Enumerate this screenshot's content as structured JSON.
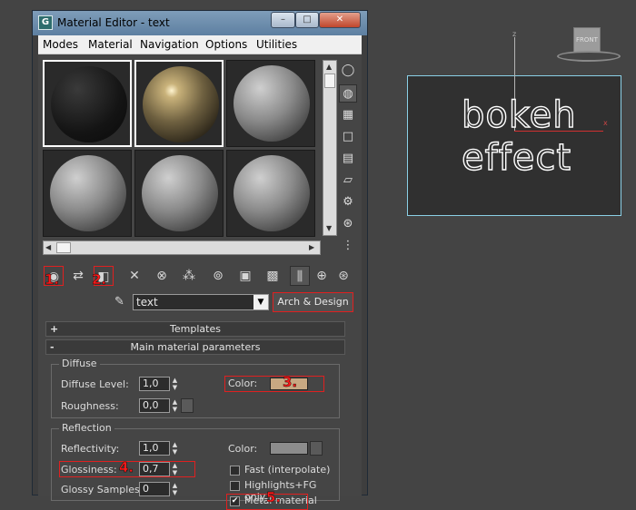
{
  "window": {
    "title": "Material Editor - text",
    "app_icon": "G",
    "minimize": "–",
    "maximize": "□",
    "close": "✕"
  },
  "menu": [
    "Modes",
    "Material",
    "Navigation",
    "Options",
    "Utilities"
  ],
  "slots": [
    {
      "sphere": "dark",
      "active": true
    },
    {
      "sphere": "gold",
      "active": true
    },
    {
      "sphere": "grey",
      "active": false
    },
    {
      "sphere": "grey",
      "active": false
    },
    {
      "sphere": "grey",
      "active": false
    },
    {
      "sphere": "grey",
      "active": false
    }
  ],
  "side_tools": [
    "sample-type-icon",
    "backlight-icon",
    "background-icon",
    "uv-tiling-icon",
    "video-color-check-icon",
    "make-preview-icon",
    "options-icon",
    "select-by-material-icon",
    "material-map-navigator-icon"
  ],
  "toolbar": {
    "icons": [
      "get-material-icon",
      "put-to-scene-icon",
      "assign-to-selection-icon",
      "reset-map-icon",
      "make-unique-icon",
      "put-to-library-icon",
      "material-id-channel-icon",
      "show-map-in-viewport-icon",
      "show-end-result-icon",
      "go-to-parent-icon",
      "go-forward-to-sibling-icon",
      "go-to-sibling-icon"
    ],
    "markers": [
      "1.",
      "2."
    ]
  },
  "material_name": {
    "value": "text",
    "dropdown_arrow": "▼",
    "type_button": "Arch & Design"
  },
  "rollouts": {
    "templates": {
      "sign": "+",
      "label": "Templates"
    },
    "main": {
      "sign": "-",
      "label": "Main material parameters"
    }
  },
  "diffuse": {
    "title": "Diffuse",
    "level_label": "Diffuse Level:",
    "level_value": "1,0",
    "roughness_label": "Roughness:",
    "roughness_value": "0,0",
    "color_label": "Color:",
    "color_hex": "#c8a882",
    "marker": "3."
  },
  "reflection": {
    "title": "Reflection",
    "reflectivity_label": "Reflectivity:",
    "reflectivity_value": "1,0",
    "glossiness_label": "Glossiness:",
    "glossiness_value": "0,7",
    "glossy_samples_label": "Glossy Samples:",
    "glossy_samples_value": "0",
    "color_label": "Color:",
    "color_hex": "#8c8c8c",
    "fast_label": "Fast (interpolate)",
    "fast_checked": false,
    "highlights_label": "Highlights+FG only",
    "highlights_checked": false,
    "metal_label": "Metal material",
    "metal_checked": true,
    "marker_glossiness": "4.",
    "marker_metal": "5."
  },
  "viewport": {
    "text_line1": "bokeh",
    "text_line2": "effect",
    "axis_x": "x",
    "axis_z": "z",
    "viewcube_label": "FRONT"
  }
}
